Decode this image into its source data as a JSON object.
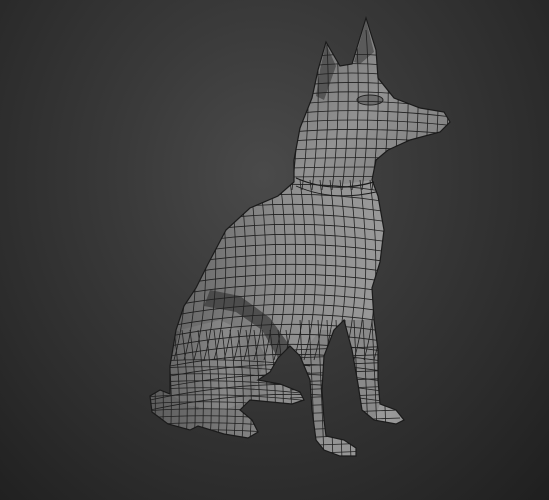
{
  "viewport": {
    "background": "#2d2d2d",
    "model_color": "#8a8a8a",
    "wire_color": "#1e1e1e",
    "subject": "dog-mesh"
  }
}
